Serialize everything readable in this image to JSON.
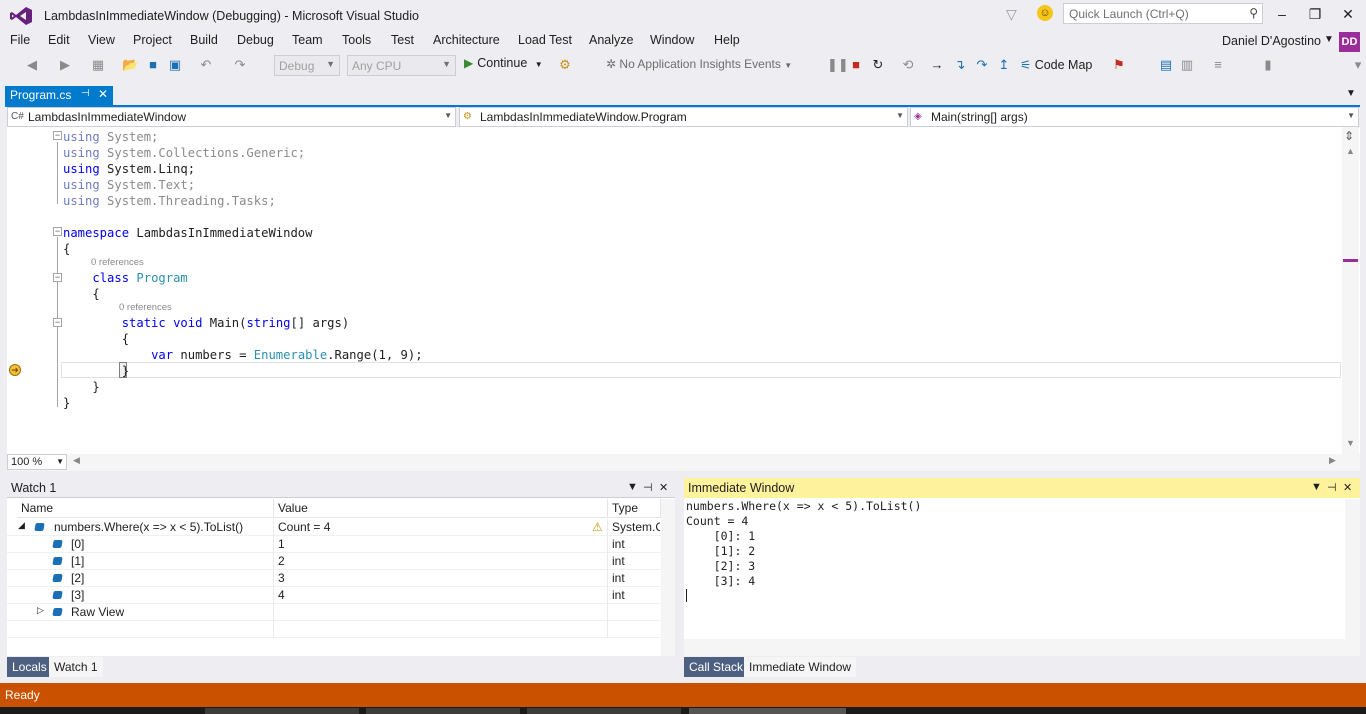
{
  "window": {
    "title": "LambdasInImmediateWindow (Debugging) - Microsoft Visual Studio",
    "quick_launch_placeholder": "Quick Launch (Ctrl+Q)",
    "user": "Daniel D'Agostino",
    "user_initials": "DD"
  },
  "menu": [
    "File",
    "Edit",
    "View",
    "Project",
    "Build",
    "Debug",
    "Team",
    "Tools",
    "Test",
    "Architecture",
    "Load Test",
    "Analyze",
    "Window",
    "Help"
  ],
  "toolbar": {
    "config": "Debug",
    "platform": "Any CPU",
    "continue": "Continue",
    "insights": "No Application Insights Events",
    "code_map": "Code Map"
  },
  "doc_tab": {
    "label": "Program.cs"
  },
  "nav": {
    "project": "LambdasInImmediateWindow",
    "type": "LambdasInImmediateWindow.Program",
    "member": "Main(string[] args)"
  },
  "editor": {
    "zoom": "100 %",
    "refs_class": "0 references",
    "refs_method": "0 references"
  },
  "watch": {
    "title": "Watch 1",
    "columns": [
      "Name",
      "Value",
      "Type"
    ],
    "rows": [
      {
        "name": "numbers.Where(x => x < 5).ToList()",
        "value": "Count = 4",
        "type": "System.C"
      },
      {
        "name": "[0]",
        "value": "1",
        "type": "int"
      },
      {
        "name": "[1]",
        "value": "2",
        "type": "int"
      },
      {
        "name": "[2]",
        "value": "3",
        "type": "int"
      },
      {
        "name": "[3]",
        "value": "4",
        "type": "int"
      },
      {
        "name": "Raw View",
        "value": "",
        "type": ""
      }
    ],
    "tabs": [
      "Locals",
      "Watch 1"
    ]
  },
  "immediate": {
    "title": "Immediate Window",
    "lines": [
      "numbers.Where(x => x < 5).ToList()",
      "Count = 4",
      "    [0]: 1",
      "    [1]: 2",
      "    [2]: 3",
      "    [3]: 4"
    ],
    "tabs": [
      "Call Stack",
      "Immediate Window"
    ]
  },
  "status": {
    "text": "Ready"
  },
  "colors": {
    "accent": "#007acc",
    "status_bar": "#ca5100",
    "immediate_header": "#fff29d",
    "vs_purple": "#68217a"
  }
}
